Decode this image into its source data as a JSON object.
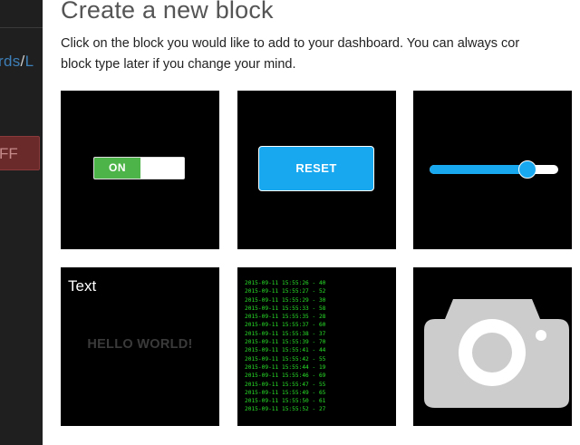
{
  "backdrop": {
    "crumb_link": "rds",
    "crumb_sep": "/",
    "crumb_next": "L",
    "off_button": "FF"
  },
  "modal": {
    "title": "Create a new block",
    "description_line1": "Click on the block you would like to add to your dashboard. You can always cor",
    "description_line2": "block type later if you change your mind."
  },
  "blocks": {
    "toggle": {
      "on_label": "ON"
    },
    "button": {
      "label": "RESET"
    },
    "slider": {
      "value_fraction": 0.76
    },
    "text": {
      "label": "Text",
      "sample": "HELLO WORLD!"
    },
    "terminal": {
      "lines": [
        "2015-09-11 15:55:26 - 40",
        "2015-09-11 15:55:27 - 52",
        "2015-09-11 15:55:29 - 30",
        "2015-09-11 15:55:33 - 58",
        "2015-09-11 15:55:35 - 28",
        "2015-09-11 15:55:37 - 60",
        "2015-09-11 15:55:38 - 37",
        "2015-09-11 15:55:39 - 70",
        "2015-09-11 15:55:41 - 44",
        "2015-09-11 15:55:42 - 55",
        "2015-09-11 15:55:44 - 19",
        "2015-09-11 15:55:46 - 69",
        "2015-09-11 15:55:47 - 55",
        "2015-09-11 15:55:49 - 65",
        "2015-09-11 15:55:50 - 61",
        "2015-09-11 15:55:52 - 27"
      ]
    },
    "camera": {
      "icon": "camera-icon"
    }
  },
  "colors": {
    "accent_blue": "#18a8ef",
    "toggle_green": "#4db44a",
    "terminal_green": "#28e028",
    "tile_bg": "#000000"
  }
}
